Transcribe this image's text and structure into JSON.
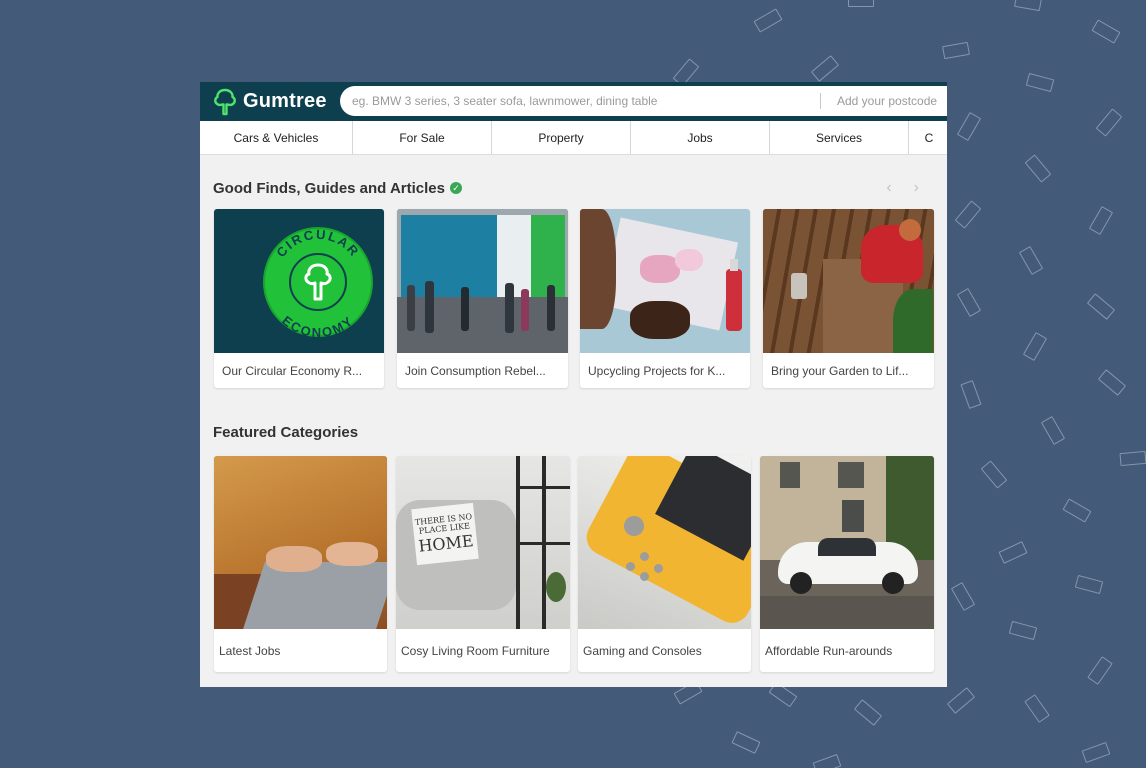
{
  "header": {
    "brand": "Gumtree",
    "search_placeholder": "eg. BMW 3 series, 3 seater sofa, lawnmower, dining table",
    "postcode_placeholder": "Add your postcode"
  },
  "nav": {
    "items": [
      {
        "label": "Cars & Vehicles"
      },
      {
        "label": "For Sale"
      },
      {
        "label": "Property"
      },
      {
        "label": "Jobs"
      },
      {
        "label": "Services"
      },
      {
        "label": "C"
      }
    ]
  },
  "articles": {
    "title": "Good Finds, Guides and Articles",
    "prev": "‹",
    "next": "›",
    "badge_words": [
      "CIRCULAR",
      "ECONOMY"
    ],
    "cards": [
      {
        "label": "Our Circular Economy R..."
      },
      {
        "label": "Join Consumption Rebel..."
      },
      {
        "label": "Upcycling Projects for K..."
      },
      {
        "label": "Bring your Garden to Lif..."
      }
    ]
  },
  "featured": {
    "title": "Featured Categories",
    "cards": [
      {
        "label": "Latest Jobs"
      },
      {
        "label": "Cosy Living Room Furniture"
      },
      {
        "label": "Gaming and Consoles"
      },
      {
        "label": "Affordable Run-arounds"
      }
    ]
  },
  "colors": {
    "header_bg": "#0e3f4e",
    "brand_green": "#4fe36a",
    "page_bg": "#435a78",
    "verified_green": "#3aa757"
  }
}
